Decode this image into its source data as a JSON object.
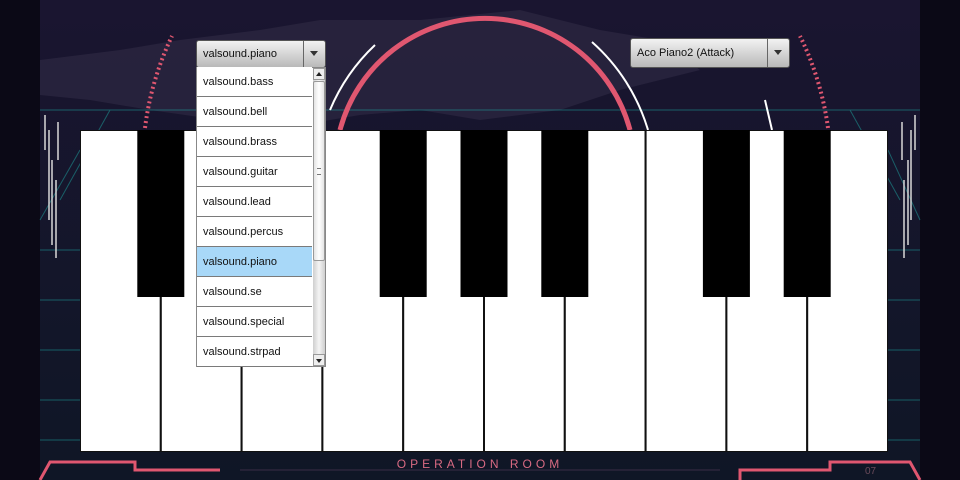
{
  "category_dropdown": {
    "value": "valsound.piano"
  },
  "category_list": {
    "items": [
      "valsound.bass",
      "valsound.bell",
      "valsound.brass",
      "valsound.guitar",
      "valsound.lead",
      "valsound.percus",
      "valsound.piano",
      "valsound.se",
      "valsound.special",
      "valsound.strpad"
    ],
    "selected": "valsound.piano"
  },
  "voice_dropdown": {
    "value": "Aco Piano2 (Attack)"
  },
  "keyboard": {
    "white_keys": 10,
    "black_keys_after_white": [
      1,
      4,
      5,
      6,
      8,
      9
    ]
  },
  "footer": {
    "title": "OPERATION ROOM",
    "page": "07"
  },
  "colors": {
    "accent": "#e05770",
    "grid": "#1fb8b0",
    "selection": "#a8d8f8"
  },
  "icons": {
    "dropdown_arrow": "chevron-down-icon"
  }
}
